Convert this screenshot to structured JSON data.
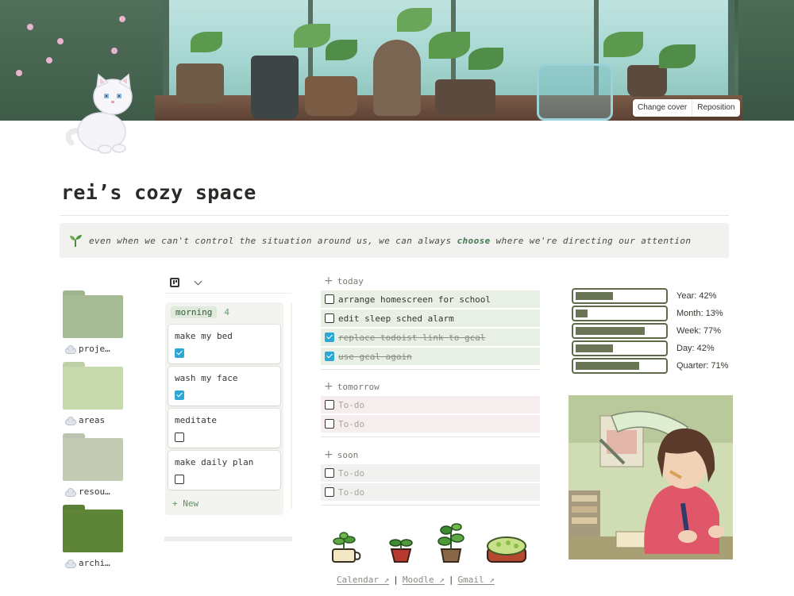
{
  "cover": {
    "change_cover": "Change cover",
    "reposition": "Reposition"
  },
  "page": {
    "title": "rei’s cozy space",
    "icon": "white-cat-icon"
  },
  "callout": {
    "icon": "seedling-icon",
    "text_before": "even when we can't control the situation around us, we can always ",
    "text_emphasis": "choose",
    "text_after": " where we're directing our attention"
  },
  "folders": [
    {
      "label": "proje…",
      "color": "#a5bb93",
      "icon": "cloud-icon"
    },
    {
      "label": "areas",
      "color": "#c5d9ad",
      "icon": "cloud-icon"
    },
    {
      "label": "resou…",
      "color": "#c4cbb5",
      "icon": "cloud-icon"
    },
    {
      "label": "archi…",
      "color": "#5e8438",
      "icon": "cloud-icon"
    }
  ],
  "board": {
    "column": "morning",
    "count": "4",
    "cards": [
      {
        "title": "make my bed",
        "checked": true
      },
      {
        "title": "wash my face",
        "checked": true
      },
      {
        "title": "meditate",
        "checked": false
      },
      {
        "title": "make daily plan",
        "checked": false
      }
    ],
    "new_label": "New"
  },
  "lists": {
    "today": {
      "label": "today",
      "items": [
        {
          "text": "arrange homescreen for school",
          "checked": false
        },
        {
          "text": "edit sleep sched alarm",
          "checked": false
        },
        {
          "text": "replace todoist link to gcal",
          "checked": true
        },
        {
          "text": "use gcal again",
          "checked": true
        }
      ]
    },
    "tomorrow": {
      "label": "tomorrow",
      "items": [
        {
          "text": "To-do",
          "checked": false
        },
        {
          "text": "To-do",
          "checked": false
        }
      ]
    },
    "soon": {
      "label": "soon",
      "items": [
        {
          "text": "To-do",
          "checked": false
        },
        {
          "text": "To-do",
          "checked": false
        }
      ]
    }
  },
  "colors": {
    "today_bg": "#e8efe5",
    "tomorrow_bg": "#f6eeee",
    "soon_bg": "#f1f1ef",
    "checked": "#2ea7d6"
  },
  "links": [
    {
      "label": "Calendar ↗"
    },
    {
      "label": "Moodle ↗"
    },
    {
      "label": "Gmail ↗"
    }
  ],
  "link_separator": "|",
  "progress": [
    {
      "label": "Year: 42%",
      "value": 0.42
    },
    {
      "label": "Month: 13%",
      "value": 0.13
    },
    {
      "label": "Week: 77%",
      "value": 0.77
    },
    {
      "label": "Day: 42%",
      "value": 0.42
    },
    {
      "label": "Quarter: 71%",
      "value": 0.71
    }
  ]
}
